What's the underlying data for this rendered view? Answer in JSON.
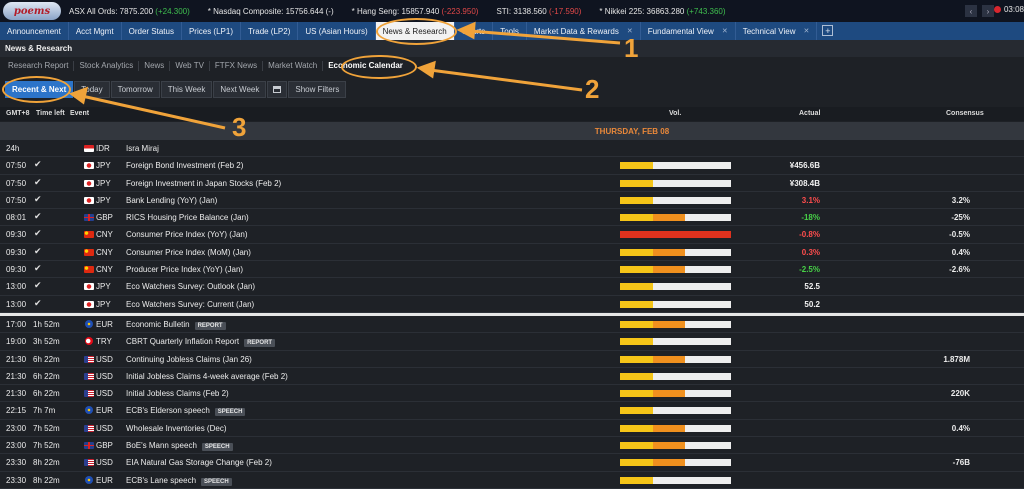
{
  "ticker": {
    "logo_text": "poems",
    "items": [
      {
        "label": "ASX All Ords: 7875.200",
        "change": "(+24.300)",
        "dir": "up"
      },
      {
        "label": "* Nasdaq Composite: 15756.644",
        "change": "(-)",
        "dir": "flat"
      },
      {
        "label": "* Hang Seng: 15857.940",
        "change": "(-223.950)",
        "dir": "dn"
      },
      {
        "label": "STI: 3138.560",
        "change": "(-17.590)",
        "dir": "dn"
      },
      {
        "label": "* Nikkei 225: 36863.280",
        "change": "(+743.360)",
        "dir": "up"
      }
    ],
    "time": "03:08"
  },
  "main_tabs": [
    {
      "label": "Announcement",
      "active": false,
      "closable": false
    },
    {
      "label": "Acct Mgmt",
      "active": false,
      "closable": false
    },
    {
      "label": "Order Status",
      "active": false,
      "closable": false
    },
    {
      "label": "Prices (LP1)",
      "active": false,
      "closable": false
    },
    {
      "label": "Trade (LP2)",
      "active": false,
      "closable": false
    },
    {
      "label": "US (Asian Hours)",
      "active": false,
      "closable": false
    },
    {
      "label": "News & Research",
      "active": true,
      "closable": false
    },
    {
      "label": "Charts",
      "active": false,
      "closable": false
    },
    {
      "label": "Tools",
      "active": false,
      "closable": false
    },
    {
      "label": "Market Data & Rewards",
      "active": false,
      "closable": true
    },
    {
      "label": "Fundamental View",
      "active": false,
      "closable": true
    },
    {
      "label": "Technical View",
      "active": false,
      "closable": true
    }
  ],
  "add_tab": "+",
  "section_title": "News & Research",
  "sub_tabs": [
    {
      "label": "Research Report",
      "active": false
    },
    {
      "label": "Stock Analytics",
      "active": false
    },
    {
      "label": "News",
      "active": false
    },
    {
      "label": "Web TV",
      "active": false
    },
    {
      "label": "FTFX News",
      "active": false
    },
    {
      "label": "Market Watch",
      "active": false
    },
    {
      "label": "Economic Calendar",
      "active": true
    }
  ],
  "filters": {
    "recent": "Recent & Next",
    "today": "Today",
    "tomorrow": "Tomorrow",
    "this_week": "This Week",
    "next_week": "Next Week",
    "show_filters": "Show Filters"
  },
  "columns": {
    "gmt": "GMT+8",
    "time_left": "Time left",
    "event": "Event",
    "vol": "Vol.",
    "actual": "Actual",
    "consensus": "Consensus"
  },
  "day_label": "THURSDAY, FEB 08",
  "colors": {
    "accent": "#2c74c9",
    "tab_bar": "#1e4a80",
    "annotation": "#f0a33a",
    "positive": "#3fbf4f",
    "negative": "#e04848"
  },
  "past_events": [
    {
      "time": "24h",
      "left": "",
      "done": false,
      "flag": "id",
      "cur": "IDR",
      "event": "Isra Miraj",
      "tag": "",
      "vol": [],
      "actual": "",
      "actual_color": "",
      "consensus": ""
    },
    {
      "time": "07:50",
      "left": "",
      "done": true,
      "flag": "jp",
      "cur": "JPY",
      "event": "Foreign Bond Investment (Feb 2)",
      "tag": "",
      "vol": [
        [
          "y",
          30
        ],
        [
          "o",
          0
        ]
      ],
      "actual": "¥456.6B",
      "actual_color": "white",
      "consensus": ""
    },
    {
      "time": "07:50",
      "left": "",
      "done": true,
      "flag": "jp",
      "cur": "JPY",
      "event": "Foreign Investment in Japan Stocks (Feb 2)",
      "tag": "",
      "vol": [
        [
          "y",
          30
        ],
        [
          "o",
          0
        ]
      ],
      "actual": "¥308.4B",
      "actual_color": "white",
      "consensus": ""
    },
    {
      "time": "07:50",
      "left": "",
      "done": true,
      "flag": "jp",
      "cur": "JPY",
      "event": "Bank Lending (YoY) (Jan)",
      "tag": "",
      "vol": [
        [
          "y",
          30
        ],
        [
          "o",
          0
        ]
      ],
      "actual": "3.1%",
      "actual_color": "red",
      "consensus": "3.2%"
    },
    {
      "time": "08:01",
      "left": "",
      "done": true,
      "flag": "gb",
      "cur": "GBP",
      "event": "RICS Housing Price Balance (Jan)",
      "tag": "",
      "vol": [
        [
          "y",
          30
        ],
        [
          "o",
          29
        ]
      ],
      "actual": "-18%",
      "actual_color": "green",
      "consensus": "-25%"
    },
    {
      "time": "09:30",
      "left": "",
      "done": true,
      "flag": "cn",
      "cur": "CNY",
      "event": "Consumer Price Index (YoY) (Jan)",
      "tag": "",
      "vol": [
        [
          "r",
          100
        ]
      ],
      "actual": "-0.8%",
      "actual_color": "red",
      "consensus": "-0.5%"
    },
    {
      "time": "09:30",
      "left": "",
      "done": true,
      "flag": "cn",
      "cur": "CNY",
      "event": "Consumer Price Index (MoM) (Jan)",
      "tag": "",
      "vol": [
        [
          "y",
          30
        ],
        [
          "o",
          29
        ]
      ],
      "actual": "0.3%",
      "actual_color": "red",
      "consensus": "0.4%"
    },
    {
      "time": "09:30",
      "left": "",
      "done": true,
      "flag": "cn",
      "cur": "CNY",
      "event": "Producer Price Index (YoY) (Jan)",
      "tag": "",
      "vol": [
        [
          "y",
          30
        ],
        [
          "o",
          29
        ]
      ],
      "actual": "-2.5%",
      "actual_color": "green",
      "consensus": "-2.6%"
    },
    {
      "time": "13:00",
      "left": "",
      "done": true,
      "flag": "jp",
      "cur": "JPY",
      "event": "Eco Watchers Survey: Outlook (Jan)",
      "tag": "",
      "vol": [
        [
          "y",
          30
        ],
        [
          "o",
          0
        ]
      ],
      "actual": "52.5",
      "actual_color": "white",
      "consensus": ""
    },
    {
      "time": "13:00",
      "left": "",
      "done": true,
      "flag": "jp",
      "cur": "JPY",
      "event": "Eco Watchers Survey: Current (Jan)",
      "tag": "",
      "vol": [
        [
          "y",
          30
        ],
        [
          "o",
          0
        ]
      ],
      "actual": "50.2",
      "actual_color": "white",
      "consensus": ""
    }
  ],
  "upcoming_events": [
    {
      "time": "17:00",
      "left": "1h 52m",
      "done": false,
      "flag": "eu",
      "cur": "EUR",
      "event": "Economic Bulletin",
      "tag": "REPORT",
      "vol": [
        [
          "y",
          30
        ],
        [
          "o",
          29
        ]
      ],
      "actual": "",
      "actual_color": "",
      "consensus": ""
    },
    {
      "time": "19:00",
      "left": "3h 52m",
      "done": false,
      "flag": "tr",
      "cur": "TRY",
      "event": "CBRT Quarterly Inflation Report",
      "tag": "REPORT",
      "vol": [
        [
          "y",
          30
        ],
        [
          "o",
          0
        ]
      ],
      "actual": "",
      "actual_color": "",
      "consensus": ""
    },
    {
      "time": "21:30",
      "left": "6h 22m",
      "done": false,
      "flag": "us",
      "cur": "USD",
      "event": "Continuing Jobless Claims (Jan 26)",
      "tag": "",
      "vol": [
        [
          "y",
          30
        ],
        [
          "o",
          29
        ]
      ],
      "actual": "",
      "actual_color": "",
      "consensus": "1.878M"
    },
    {
      "time": "21:30",
      "left": "6h 22m",
      "done": false,
      "flag": "us",
      "cur": "USD",
      "event": "Initial Jobless Claims 4-week average (Feb 2)",
      "tag": "",
      "vol": [
        [
          "y",
          30
        ],
        [
          "o",
          0
        ]
      ],
      "actual": "",
      "actual_color": "",
      "consensus": ""
    },
    {
      "time": "21:30",
      "left": "6h 22m",
      "done": false,
      "flag": "us",
      "cur": "USD",
      "event": "Initial Jobless Claims (Feb 2)",
      "tag": "",
      "vol": [
        [
          "y",
          30
        ],
        [
          "o",
          29
        ]
      ],
      "actual": "",
      "actual_color": "",
      "consensus": "220K"
    },
    {
      "time": "22:15",
      "left": "7h 7m",
      "done": false,
      "flag": "eu",
      "cur": "EUR",
      "event": "ECB's Elderson speech",
      "tag": "SPEECH",
      "vol": [
        [
          "y",
          30
        ],
        [
          "o",
          0
        ]
      ],
      "actual": "",
      "actual_color": "",
      "consensus": ""
    },
    {
      "time": "23:00",
      "left": "7h 52m",
      "done": false,
      "flag": "us",
      "cur": "USD",
      "event": "Wholesale Inventories (Dec)",
      "tag": "",
      "vol": [
        [
          "y",
          30
        ],
        [
          "o",
          29
        ]
      ],
      "actual": "",
      "actual_color": "",
      "consensus": "0.4%"
    },
    {
      "time": "23:00",
      "left": "7h 52m",
      "done": false,
      "flag": "gb",
      "cur": "GBP",
      "event": "BoE's Mann speech",
      "tag": "SPEECH",
      "vol": [
        [
          "y",
          30
        ],
        [
          "o",
          29
        ]
      ],
      "actual": "",
      "actual_color": "",
      "consensus": ""
    },
    {
      "time": "23:30",
      "left": "8h 22m",
      "done": false,
      "flag": "us",
      "cur": "USD",
      "event": "EIA Natural Gas Storage Change (Feb 2)",
      "tag": "",
      "vol": [
        [
          "y",
          30
        ],
        [
          "o",
          29
        ]
      ],
      "actual": "",
      "actual_color": "",
      "consensus": "-76B"
    },
    {
      "time": "23:30",
      "left": "8h 22m",
      "done": false,
      "flag": "eu",
      "cur": "EUR",
      "event": "ECB's Lane speech",
      "tag": "SPEECH",
      "vol": [
        [
          "y",
          30
        ],
        [
          "o",
          0
        ]
      ],
      "actual": "",
      "actual_color": "",
      "consensus": ""
    }
  ],
  "annotations": {
    "n1": "1",
    "n2": "2",
    "n3": "3"
  }
}
